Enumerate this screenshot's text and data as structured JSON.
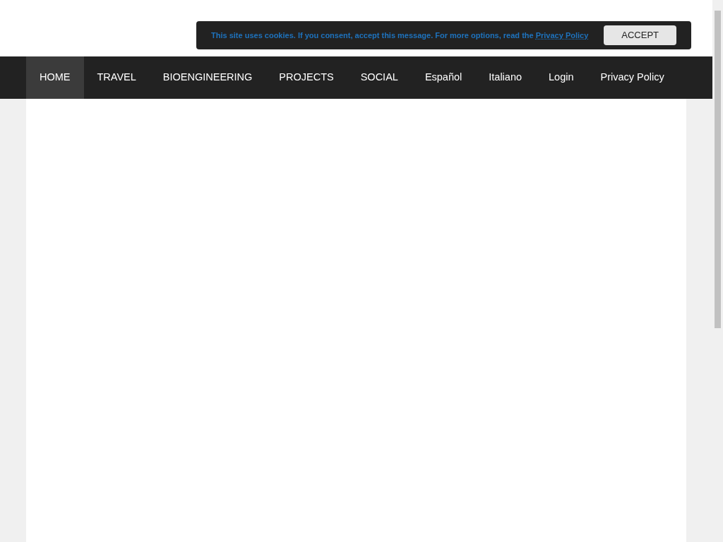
{
  "cookie_notice": {
    "message": "This site uses cookies. If you consent, accept this message. For more options, read the",
    "link": "Privacy Policy",
    "button": "ACCEPT"
  },
  "nav": [
    {
      "label": "HOME",
      "selected": true
    },
    {
      "label": "TRAVEL",
      "selected": false
    },
    {
      "label": "BIOENGINEERING",
      "selected": false
    },
    {
      "label": "PROJECTS",
      "selected": false
    },
    {
      "label": "SOCIAL",
      "selected": false
    },
    {
      "label": "Español",
      "selected": false
    },
    {
      "label": "Italiano",
      "selected": false
    },
    {
      "label": "Login",
      "selected": false
    },
    {
      "label": "Privacy Policy",
      "selected": false
    }
  ]
}
